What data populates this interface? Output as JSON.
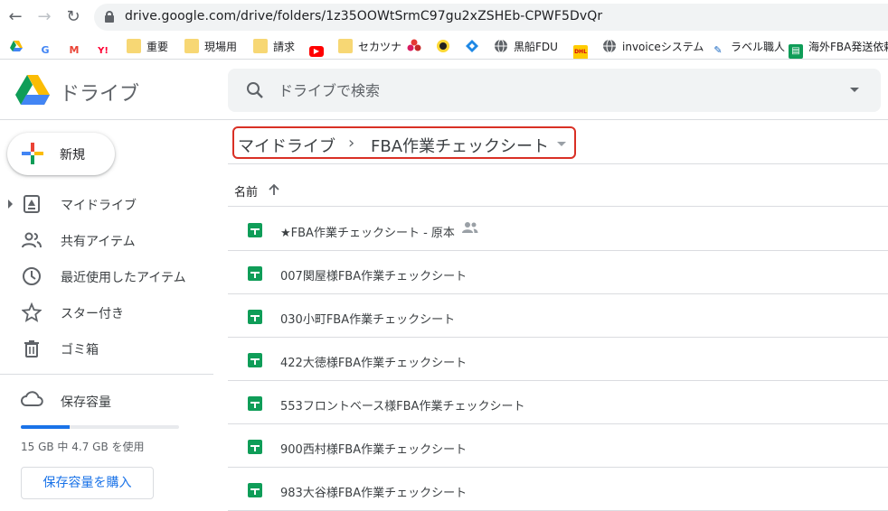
{
  "browser": {
    "url": "drive.google.com/drive/folders/1z35OOWtSrmC97gu2xZSHEb-CPWF5DvQr",
    "bookmarks": [
      {
        "label": "",
        "icon": "google-drive-icon"
      },
      {
        "label": "",
        "icon": "google-icon"
      },
      {
        "label": "",
        "icon": "gmail-icon"
      },
      {
        "label": "",
        "icon": "yahoo-icon"
      },
      {
        "label": "重要",
        "icon": "folder-icon"
      },
      {
        "label": "現場用",
        "icon": "folder-icon"
      },
      {
        "label": "請求",
        "icon": "folder-icon"
      },
      {
        "label": "",
        "icon": "youtube-icon"
      },
      {
        "label": "セカツナ",
        "icon": "folder-icon"
      },
      {
        "label": "",
        "icon": "flower-icon"
      },
      {
        "label": "",
        "icon": "yamato-icon"
      },
      {
        "label": "",
        "icon": "diamond-icon"
      },
      {
        "label": "黒船FDU",
        "icon": "globe-icon"
      },
      {
        "label": "",
        "icon": "dhl-icon"
      },
      {
        "label": "invoiceシステム",
        "icon": "globe-icon"
      },
      {
        "label": "ラベル職人",
        "icon": "label-icon"
      },
      {
        "label": "海外FBA発送依頼",
        "icon": "sheets-icon"
      }
    ]
  },
  "header": {
    "brand": "ドライブ",
    "search_placeholder": "ドライブで検索"
  },
  "sidebar": {
    "new_label": "新規",
    "items": [
      {
        "label": "マイドライブ",
        "icon": "my-drive-icon"
      },
      {
        "label": "共有アイテム",
        "icon": "shared-people-icon"
      },
      {
        "label": "最近使用したアイテム",
        "icon": "clock-icon"
      },
      {
        "label": "スター付き",
        "icon": "star-icon"
      },
      {
        "label": "ゴミ箱",
        "icon": "trash-icon"
      }
    ],
    "storage": {
      "title": "保存容量",
      "used_text": "15 GB 中 4.7 GB を使用",
      "used_fraction": 0.31,
      "buy_label": "保存容量を購入"
    }
  },
  "main": {
    "breadcrumb": {
      "root": "マイドライブ",
      "current": "FBA作業チェックシート"
    },
    "column_name": "名前",
    "files": [
      {
        "name": "★FBA作業チェックシート - 原本",
        "shared": true
      },
      {
        "name": "007関屋様FBA作業チェックシート",
        "shared": false
      },
      {
        "name": "030小町FBA作業チェックシート",
        "shared": false
      },
      {
        "name": "422大徳様FBA作業チェックシート",
        "shared": false
      },
      {
        "name": "553フロントベース様FBA作業チェックシート",
        "shared": false
      },
      {
        "name": "900西村様FBA作業チェックシート",
        "shared": false
      },
      {
        "name": "983大谷様FBA作業チェックシート",
        "shared": false
      }
    ]
  },
  "colors": {
    "accent": "#1a73e8",
    "highlight": "#d93025",
    "sheets": "#0f9d58"
  }
}
